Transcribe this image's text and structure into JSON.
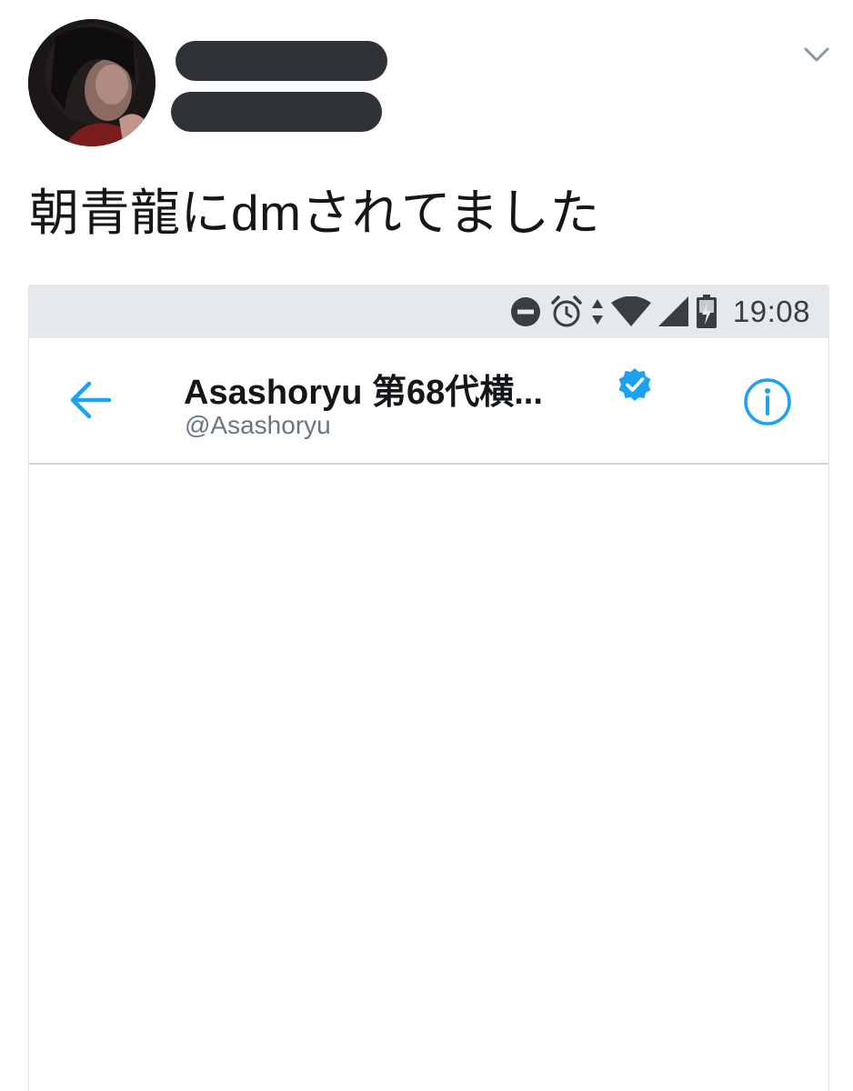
{
  "tweet": {
    "text": "朝青龍にdmされてました",
    "author_avatar_icon": "user-avatar",
    "caret_icon": "chevron-down-icon"
  },
  "screenshot": {
    "status_bar": {
      "time": "19:08",
      "icons": [
        "do-not-disturb-icon",
        "alarm-icon",
        "data-arrows-icon",
        "wifi-icon",
        "cell-signal-icon",
        "battery-charging-icon"
      ]
    },
    "app_bar": {
      "name": "Asashoryu 第68代横...",
      "handle": "@Asashoryu",
      "back_icon": "back-arrow-icon",
      "verified_icon": "verified-badge-icon",
      "info_icon": "info-icon"
    }
  },
  "colors": {
    "accent": "#1da1f2",
    "text": "#14171a",
    "muted": "#657786",
    "status_bar_bg": "#e6e9ec",
    "redaction": "#2f3236"
  }
}
